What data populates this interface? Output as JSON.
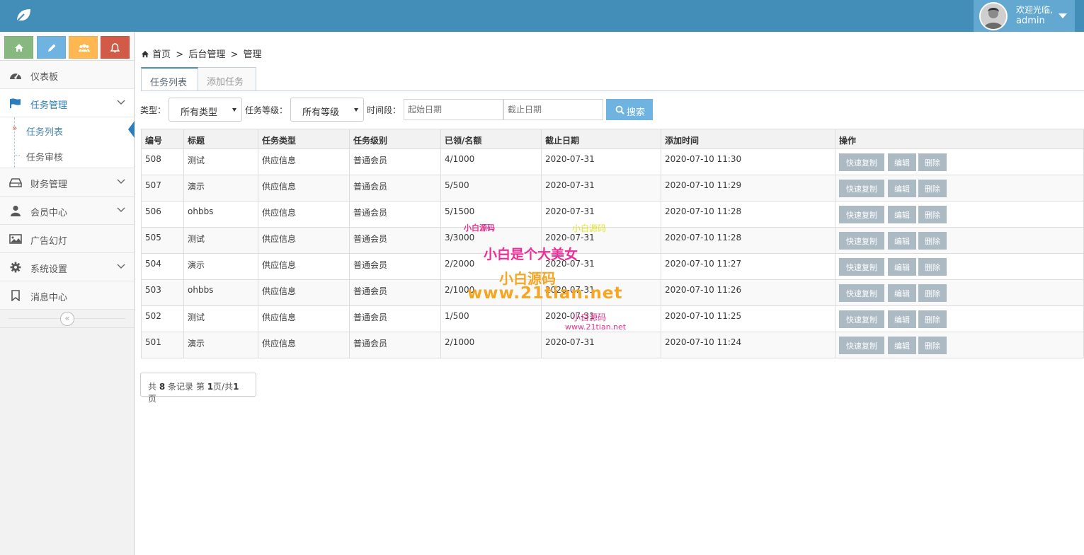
{
  "header": {
    "welcome": "欢迎光临,",
    "username": "admin"
  },
  "shortcuts": [
    {
      "icon": "home-icon",
      "color": "#87b87f"
    },
    {
      "icon": "pencil-icon",
      "color": "#6fb3e0"
    },
    {
      "icon": "users-icon",
      "color": "#ffb752"
    },
    {
      "icon": "bell-icon",
      "color": "#d15b47"
    }
  ],
  "sidebar": {
    "items": [
      {
        "label": "仪表板",
        "icon": "dashboard-icon"
      },
      {
        "label": "任务管理",
        "icon": "flag-icon"
      },
      {
        "label": "财务管理",
        "icon": "hdd-icon"
      },
      {
        "label": "会员中心",
        "icon": "user-icon"
      },
      {
        "label": "广告幻灯",
        "icon": "picture-icon"
      },
      {
        "label": "系统设置",
        "icon": "cog-icon"
      },
      {
        "label": "消息中心",
        "icon": "bookmark-icon"
      }
    ],
    "subitems": [
      {
        "label": "任务列表"
      },
      {
        "label": "任务审核"
      }
    ]
  },
  "breadcrumb": [
    "首页",
    ">",
    "后台管理",
    ">",
    "管理"
  ],
  "tabs": [
    {
      "label": "任务列表"
    },
    {
      "label": "添加任务"
    }
  ],
  "filters": {
    "type_label": "类型：",
    "type_value": "所有类型",
    "level_label": "任务等级：",
    "level_value": "所有等级",
    "period_label": "时间段：",
    "start_placeholder": "起始日期",
    "end_placeholder": "截止日期",
    "search_label": "搜索"
  },
  "table": {
    "columns": [
      "编号",
      "标题",
      "任务类型",
      "任务级别",
      "已领/名额",
      "截止日期",
      "添加时间",
      "操作"
    ],
    "rows": [
      [
        "508",
        "测试",
        "供应信息",
        "普通会员",
        "4/1000",
        "2020-07-31",
        "2020-07-10 11:30"
      ],
      [
        "507",
        "演示",
        "供应信息",
        "普通会员",
        "5/500",
        "2020-07-31",
        "2020-07-10 11:29"
      ],
      [
        "506",
        "ohbbs",
        "供应信息",
        "普通会员",
        "5/1500",
        "2020-07-31",
        "2020-07-10 11:28"
      ],
      [
        "505",
        "测试",
        "供应信息",
        "普通会员",
        "3/3000",
        "2020-07-31",
        "2020-07-10 11:28"
      ],
      [
        "504",
        "演示",
        "供应信息",
        "普通会员",
        "2/2000",
        "2020-07-31",
        "2020-07-10 11:27"
      ],
      [
        "503",
        "ohbbs",
        "供应信息",
        "普通会员",
        "2/1000",
        "2020-07-31",
        "2020-07-10 11:26"
      ],
      [
        "502",
        "测试",
        "供应信息",
        "普通会员",
        "1/500",
        "2020-07-31",
        "2020-07-10 11:25"
      ],
      [
        "501",
        "演示",
        "供应信息",
        "普通会员",
        "2/1000",
        "2020-07-31",
        "2020-07-10 11:24"
      ]
    ],
    "actions": [
      "快速复制",
      "编辑",
      "删除"
    ]
  },
  "pager": {
    "prefix": "共",
    "total": "8",
    "mid": "条记录 第",
    "page": "1",
    "mid2": "页/共",
    "pages": "1",
    "suffix": "页"
  },
  "watermark": {
    "line1": "小白源码",
    "line2": "www.21tian.net",
    "line3": "小白是个大美女",
    "line4": "小白源码",
    "line5": "www.21tian.net"
  },
  "colors": {
    "topbar": "#438eb9",
    "accent": "#2b7dbc",
    "action_button": "#abbac3",
    "search_button": "#6fb3e0"
  }
}
